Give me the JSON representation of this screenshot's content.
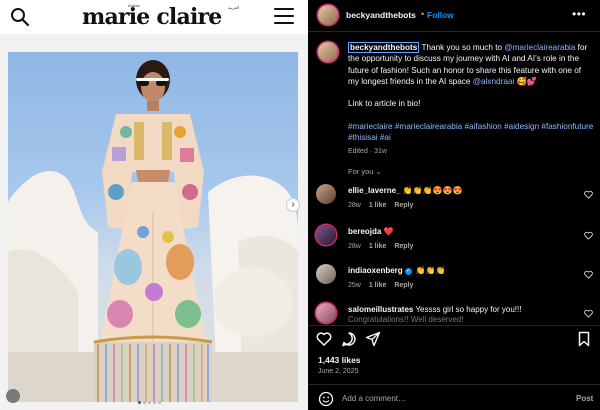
{
  "site": {
    "logo": "marie claire",
    "logo_top": "Arabia",
    "logo_sub": "العربية",
    "search_icon": "search-icon",
    "menu_icon": "hamburger-menu-icon"
  },
  "post": {
    "username": "beckyandthebots",
    "follow_label": "Follow",
    "dot": "•",
    "more_icon": "more-horizontal-icon",
    "caption": {
      "username": "beckyandthebots",
      "text_1": " Thank you so much to ",
      "mention_1": "@marieclairearabia",
      "text_2": " for the opportunity to discuss my journey with AI and AI’s role in the future of fashion! Such an honor to share this feature with one of my longest friends in the AI space ",
      "mention_2": "@alxndraai",
      "text_3": " 🥰💕",
      "line_2": "Link to article in bio!",
      "hashtags": "#marieclaire #marieclairearabia #aifashion #aidesign #fashionfuture #thisisai #ai",
      "edited": "Edited · 31w"
    },
    "replies_label": "For you ⌄",
    "comments": [
      {
        "user": "ellie_laverne_",
        "text": " 👏👏👏😍😍😍",
        "age": "28w",
        "likes": "1 like",
        "reply": "Reply"
      },
      {
        "user": "bereojda",
        "text": " ❤️",
        "age": "28w",
        "likes": "1 like",
        "reply": "Reply"
      },
      {
        "user": "indiaoxenberg",
        "verified": "✓",
        "text": " 👏👏👏",
        "age": "25w",
        "likes": "1 like",
        "reply": "Reply"
      },
      {
        "user": "salomeillustrates",
        "text": " Yessss girl so happy for you!!!",
        "text_2": "Congratulations!! Well deserved!",
        "age": "",
        "likes": "",
        "reply": ""
      }
    ],
    "like_count": "1,443 likes",
    "date": "June 2, 2025",
    "add_comment_placeholder": "Add a comment…",
    "post_label": "Post"
  },
  "colors": {
    "accent": "#0095f6",
    "background": "#000000",
    "muted": "#a8a8a8",
    "link": "#8fb8ff"
  }
}
